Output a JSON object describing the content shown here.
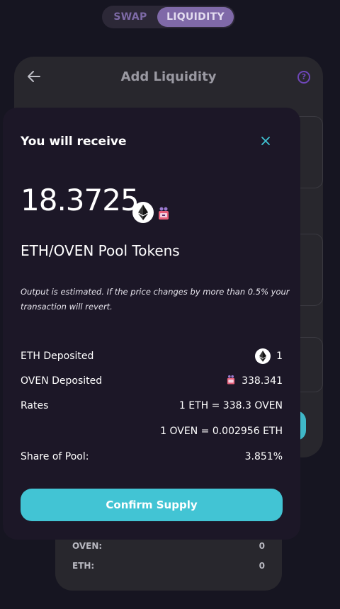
{
  "toggle": {
    "swap": "SWAP",
    "liquidity": "LIQUIDITY"
  },
  "card": {
    "title": "Add Liquidity",
    "help_glyph": "?"
  },
  "modal": {
    "heading": "You will receive",
    "amount": "18.3725",
    "pool_name": "ETH/OVEN Pool Tokens",
    "note": "Output is estimated. If the price changes by more than 0.5% your transaction will revert.",
    "eth_deposited_label": "ETH Deposited",
    "eth_deposited_value": "1",
    "oven_deposited_label": "OVEN Deposited",
    "oven_deposited_value": "338.341",
    "rates_label": "Rates",
    "rate_1": "1 ETH = 338.3 OVEN",
    "rate_2": "1 OVEN = 0.002956 ETH",
    "share_label": "Share of Pool:",
    "share_value": "3.851%",
    "confirm_label": "Confirm Supply"
  },
  "bottom": {
    "oven_label": "OVEN:",
    "oven_value": "0",
    "eth_label": "ETH:",
    "eth_value": "0"
  },
  "colors": {
    "accent": "#42c4d4",
    "purple": "#7f69a8",
    "modal_bg": "#1c1727",
    "page_bg": "#161521"
  }
}
